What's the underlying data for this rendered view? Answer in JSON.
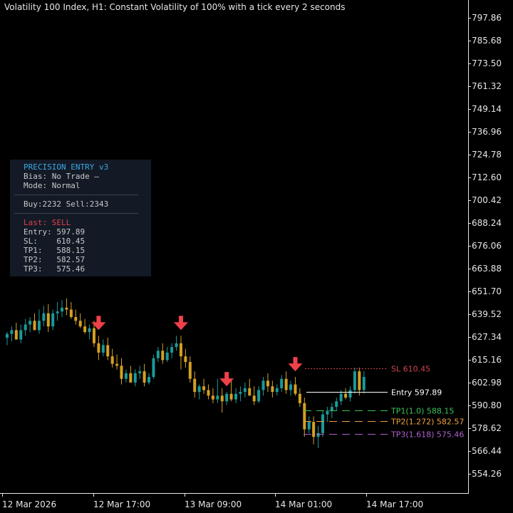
{
  "header": {
    "title": "Volatility 100 Index, H1:  Constant Volatility of 100% with a tick every 2 seconds"
  },
  "panel": {
    "title": "PRECISION ENTRY v3",
    "bias": "Bias: No Trade —",
    "mode": "Mode: Normal",
    "counts": "Buy:2232 Sell:2343",
    "last": "Last: SELL",
    "entry": "Entry: 597.89",
    "sl": "SL:    610.45",
    "tp1": "TP1:   588.15",
    "tp2": "TP2:   582.57",
    "tp3": "TP3:   575.46"
  },
  "levels": [
    {
      "label": "SL 610.45",
      "price": 610.45,
      "color": "#d0454b",
      "style": "dotted"
    },
    {
      "label": "Entry 597.89",
      "price": 597.89,
      "color": "#ffffff",
      "style": "solid"
    },
    {
      "label": "TP1(1.0) 588.15",
      "price": 588.15,
      "color": "#3cc45a",
      "style": "dashed"
    },
    {
      "label": "TP2(1.272) 582.57",
      "price": 582.57,
      "color": "#f0a040",
      "style": "dashed"
    },
    {
      "label": "TP3(1.618) 575.46",
      "price": 575.46,
      "color": "#b060d0",
      "style": "dashed"
    }
  ],
  "colors": {
    "background": "#000000",
    "bull": "#1a9a9a",
    "bear": "#d4a020",
    "arrow": "#f0404a",
    "axis": "#e6e6e6",
    "panel_title": "#3aa8e0",
    "panel_last": "#e0404a"
  },
  "chart_data": {
    "type": "candlestick",
    "y_ticks": [
      "797.86",
      "785.68",
      "773.50",
      "761.32",
      "749.14",
      "736.96",
      "724.78",
      "712.60",
      "700.42",
      "688.24",
      "676.06",
      "663.88",
      "651.70",
      "639.52",
      "627.34",
      "615.16",
      "602.98",
      "590.80",
      "578.62",
      "566.44",
      "554.26"
    ],
    "x_ticks": [
      "12 Mar 2026",
      "12 Mar 17:00",
      "13 Mar 09:00",
      "14 Mar 01:00",
      "14 Mar 17:00"
    ],
    "ylim": [
      549.0,
      800.0
    ],
    "candles": [
      [
        627,
        630,
        623,
        629
      ],
      [
        629,
        633,
        625,
        631
      ],
      [
        631,
        635,
        627,
        626
      ],
      [
        626,
        634,
        624,
        631
      ],
      [
        631,
        637,
        628,
        634
      ],
      [
        634,
        638,
        630,
        636
      ],
      [
        636,
        640,
        632,
        631
      ],
      [
        631,
        642,
        629,
        636
      ],
      [
        636,
        644,
        633,
        640
      ],
      [
        640,
        645,
        630,
        633
      ],
      [
        633,
        642,
        631,
        640
      ],
      [
        640,
        646,
        636,
        641
      ],
      [
        641,
        647,
        638,
        643
      ],
      [
        643,
        648,
        639,
        642
      ],
      [
        642,
        646,
        637,
        638
      ],
      [
        638,
        642,
        634,
        636
      ],
      [
        636,
        640,
        632,
        633
      ],
      [
        633,
        637,
        629,
        630
      ],
      [
        630,
        634,
        626,
        632
      ],
      [
        632,
        636,
        622,
        624
      ],
      [
        624,
        628,
        615,
        619
      ],
      [
        619,
        626,
        617,
        623
      ],
      [
        623,
        627,
        615,
        617
      ],
      [
        617,
        621,
        611,
        613
      ],
      [
        613,
        618,
        610,
        612
      ],
      [
        612,
        616,
        602,
        605
      ],
      [
        605,
        610,
        603,
        608
      ],
      [
        608,
        612,
        604,
        603
      ],
      [
        603,
        610,
        601,
        608
      ],
      [
        608,
        612,
        605,
        609
      ],
      [
        609,
        613,
        601,
        603
      ],
      [
        603,
        608,
        602,
        606
      ],
      [
        606,
        618,
        605,
        616
      ],
      [
        616,
        622,
        614,
        620
      ],
      [
        620,
        624,
        613,
        615
      ],
      [
        615,
        622,
        614,
        619
      ],
      [
        619,
        624,
        616,
        622
      ],
      [
        622,
        628,
        620,
        624
      ],
      [
        624,
        628,
        610,
        617
      ],
      [
        617,
        621,
        611,
        614
      ],
      [
        614,
        617,
        603,
        605
      ],
      [
        605,
        609,
        595,
        598
      ],
      [
        598,
        602,
        594,
        601
      ],
      [
        601,
        605,
        597,
        599
      ],
      [
        599,
        602,
        594,
        596
      ],
      [
        596,
        600,
        592,
        594
      ],
      [
        594,
        605,
        592,
        596
      ],
      [
        596,
        600,
        587,
        593
      ],
      [
        593,
        598,
        591,
        597
      ],
      [
        597,
        604,
        593,
        594
      ],
      [
        594,
        600,
        592,
        597
      ],
      [
        597,
        601,
        593,
        598
      ],
      [
        598,
        603,
        595,
        600
      ],
      [
        600,
        605,
        597,
        596
      ],
      [
        596,
        601,
        591,
        593
      ],
      [
        593,
        601,
        592,
        599
      ],
      [
        599,
        606,
        596,
        604
      ],
      [
        604,
        608,
        598,
        601
      ],
      [
        601,
        604,
        595,
        598
      ],
      [
        598,
        602,
        596,
        600
      ],
      [
        600,
        607,
        598,
        605
      ],
      [
        605,
        609,
        597,
        599
      ],
      [
        599,
        604,
        596,
        602
      ],
      [
        602,
        606,
        596,
        597
      ],
      [
        597,
        600,
        590,
        592
      ],
      [
        592,
        595,
        574,
        578
      ],
      [
        578,
        585,
        576,
        582
      ],
      [
        582,
        585,
        570,
        574
      ],
      [
        574,
        580,
        568,
        576
      ],
      [
        576,
        588,
        574,
        586
      ],
      [
        586,
        590,
        582,
        588
      ],
      [
        588,
        592,
        584,
        590
      ],
      [
        590,
        595,
        588,
        593
      ],
      [
        593,
        599,
        591,
        597
      ],
      [
        597,
        600,
        594,
        595
      ],
      [
        595,
        601,
        593,
        599
      ],
      [
        599,
        611,
        597,
        609
      ],
      [
        609,
        611,
        596,
        599
      ],
      [
        599,
        609,
        597,
        606
      ]
    ],
    "signals": [
      20,
      38,
      48,
      63
    ]
  }
}
